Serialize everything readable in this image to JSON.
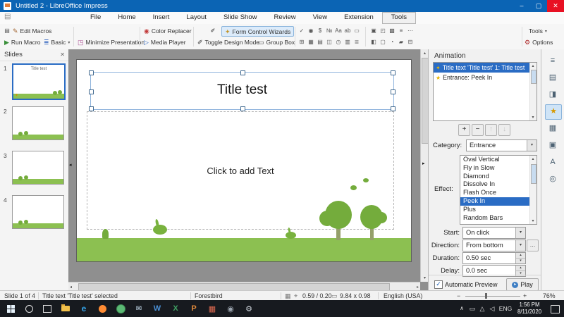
{
  "ui": {
    "dropdown_arrow": "▾",
    "spin_up": "▴",
    "spin_down": "▾",
    "scroll_up": "▴",
    "scroll_down": "▾",
    "scroll_left": "◂",
    "scroll_right": "▸",
    "splitter_left": "◂",
    "splitter_right": "▸",
    "check": "✓",
    "play_glyph": "▸"
  },
  "titlebar": {
    "title": "Untitled 2 - LibreOffice Impress",
    "minimize": "–",
    "maximize": "▢",
    "close": "✕"
  },
  "menubar": {
    "menu_icon": "▤",
    "tabs": [
      "File",
      "Home",
      "Insert",
      "Layout",
      "Slide Show",
      "Review",
      "View",
      "Extension",
      "Tools"
    ],
    "active_tab": "Tools"
  },
  "toolbar": {
    "doc_icon": "▤",
    "edit_macros": {
      "icon": "✎",
      "label": "Edit Macros"
    },
    "run_macro": {
      "icon": "▶",
      "label": "Run Macro"
    },
    "basic": {
      "icon": "≣",
      "label": "Basic"
    },
    "minimize_presentation": {
      "icon": "◳",
      "label": "Minimize Presentation"
    },
    "color_replacer": {
      "icon": "◉",
      "label": "Color Replacer"
    },
    "media_player": {
      "icon": "▷",
      "label": "Media Player"
    },
    "toggle_design_mode": {
      "icon": "✐",
      "label": "Toggle Design Mode"
    },
    "form_control_wizards": {
      "icon": "✦",
      "label": "Form Control Wizards"
    },
    "group_box": {
      "icon": "▭",
      "label": "Group Box"
    },
    "form_icons_row1": [
      "✓",
      "◉",
      "$",
      "№",
      "Aa",
      "ab",
      "▭"
    ],
    "form_icons_row2": [
      "⊞",
      "▦",
      "▤",
      "◫",
      "◷",
      "▥",
      "≣"
    ],
    "more_icons_row1": [
      "▣",
      "◰",
      "▩",
      "≡",
      "⋯"
    ],
    "more_icons_row2": [
      "◧",
      "▢",
      "◔",
      "▰",
      "⊟"
    ],
    "tools_menu": {
      "label": "Tools"
    },
    "options": {
      "icon": "⚙",
      "label": "Options"
    }
  },
  "slides_panel": {
    "header": "Slides",
    "close_icon": "✕",
    "slides": [
      {
        "number": "1"
      },
      {
        "number": "2"
      },
      {
        "number": "3"
      },
      {
        "number": "4"
      }
    ]
  },
  "slide": {
    "title": "Title test",
    "body_placeholder": "Click to add Text"
  },
  "animation_panel": {
    "title": "Animation",
    "list": [
      {
        "icon": "✦",
        "text": "Title text 'Title test' 1: Title test"
      },
      {
        "icon": "★",
        "text": "Entrance: Peek In"
      }
    ],
    "add_button": "+",
    "remove_button": "−",
    "move_up_button": "↑",
    "move_down_button": "↓",
    "category_label": "Category:",
    "category_value": "Entrance",
    "effect_label": "Effect:",
    "effects": [
      "Oval Vertical",
      "Fly in Slow",
      "Diamond",
      "Dissolve In",
      "Flash Once",
      "Peek In",
      "Plus",
      "Random Bars"
    ],
    "selected_effect": "Peek In",
    "start_label": "Start:",
    "start_value": "On click",
    "direction_label": "Direction:",
    "direction_value": "From bottom",
    "direction_options_icon": "…",
    "duration_label": "Duration:",
    "duration_value": "0.50 sec",
    "delay_label": "Delay:",
    "delay_value": "0.0 sec",
    "automatic_preview_label": "Automatic Preview",
    "play_label": "Play"
  },
  "sidebar_tabs": [
    {
      "name": "sidebar-settings",
      "glyph": "≡"
    },
    {
      "name": "properties",
      "glyph": "▤"
    },
    {
      "name": "slide-transition",
      "glyph": "◨"
    },
    {
      "name": "animation",
      "glyph": "★",
      "active": true
    },
    {
      "name": "master-slides",
      "glyph": "▦"
    },
    {
      "name": "gallery",
      "glyph": "▣"
    },
    {
      "name": "styles",
      "glyph": "A"
    },
    {
      "name": "navigator",
      "glyph": "◎"
    }
  ],
  "status_bar": {
    "slide_info": "Slide 1 of 4",
    "selection_info": "Title text 'Title test' selected",
    "template_name": "Forestbird",
    "fit_icon": "▦",
    "position_icon": "⌖",
    "position": "0.59 / 0.20",
    "size_icon": "▭",
    "size": "9.84 x 0.98",
    "language": "English (USA)",
    "zoom_out": "−",
    "zoom_in": "+",
    "zoom_percent": "76%"
  },
  "taskbar": {
    "apps": [
      {
        "name": "edge",
        "glyph": "e",
        "color": "#35a3e8"
      },
      {
        "name": "mail",
        "glyph": "✉",
        "color": "#cfe6f8"
      },
      {
        "name": "word",
        "glyph": "W",
        "color": "#4a8fd4"
      },
      {
        "name": "excel",
        "glyph": "X",
        "color": "#3f9e63"
      },
      {
        "name": "powerpoint",
        "glyph": "P",
        "color": "#e08a3c"
      },
      {
        "name": "impress",
        "glyph": "▦",
        "color": "#e06a50"
      },
      {
        "name": "gimp",
        "glyph": "◉",
        "color": "#9aa3ad"
      },
      {
        "name": "settings",
        "glyph": "⚙",
        "color": "#cfd6dd"
      }
    ],
    "tray": {
      "chevron": "∧",
      "battery": "▭",
      "network": "△",
      "volume": "◁",
      "language": "ENG",
      "time": "1:56 PM",
      "date": "8/11/2020"
    }
  },
  "colors": {
    "titlebar_blue": "#0b64b4",
    "selection_blue": "#2a6cc4",
    "grass_green": "#8cc051",
    "tree_green": "#74ac3c",
    "highlight_box": "#dcebfa"
  }
}
